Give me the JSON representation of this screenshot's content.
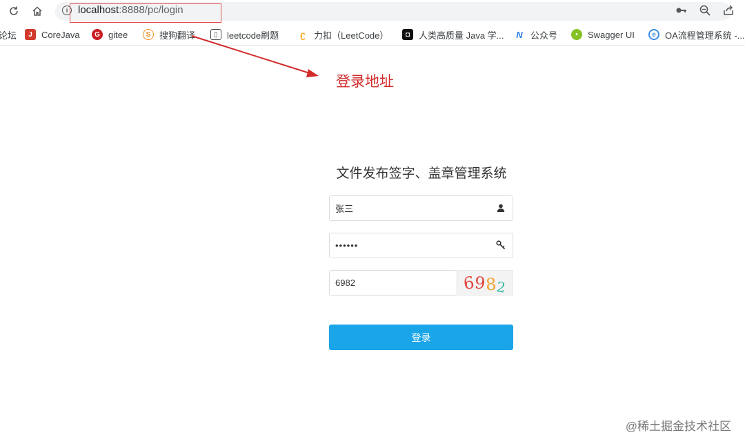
{
  "browser": {
    "url_host": "localhost",
    "url_rest": ":8888/pc/login"
  },
  "bookmarks": [
    {
      "label": "论坛",
      "icon": "forum-icon",
      "color": "#ffffff"
    },
    {
      "label": "CoreJava",
      "icon": "corejava-icon",
      "color": "#d33a2c"
    },
    {
      "label": "gitee",
      "icon": "gitee-icon",
      "color": "#c71d23"
    },
    {
      "label": "搜狗翻译",
      "icon": "sogou-icon",
      "color": "#f08c1e"
    },
    {
      "label": "leetcode刷题",
      "icon": "book-icon",
      "color": "#444444"
    },
    {
      "label": "力扣（LeetCode）",
      "icon": "leetcode-icon",
      "color": "#f5a623"
    },
    {
      "label": "人类高质量 Java 学...",
      "icon": "java-site-icon",
      "color": "#111111"
    },
    {
      "label": "公众号",
      "icon": "wechat-mp-icon",
      "color": "#2b7de9"
    },
    {
      "label": "Swagger UI",
      "icon": "swagger-icon",
      "color": "#85c226"
    },
    {
      "label": "OA流程管理系统 -...",
      "icon": "oa-icon",
      "color": "#3a8ee6"
    }
  ],
  "annotation": "登录地址",
  "login": {
    "title": "文件发布签字、盖章管理系统",
    "username_value": "张三",
    "password_value": "••••••",
    "captcha_value": "6982",
    "captcha_digits": [
      {
        "char": "6",
        "color": "#e0463c"
      },
      {
        "char": "9",
        "color": "#e0463c"
      },
      {
        "char": "8",
        "color": "#f0a030"
      },
      {
        "char": "2",
        "color": "#30b8a0"
      }
    ],
    "button_label": "登录",
    "button_color": "#1aa5e8"
  },
  "watermark": "@稀土掘金技术社区"
}
